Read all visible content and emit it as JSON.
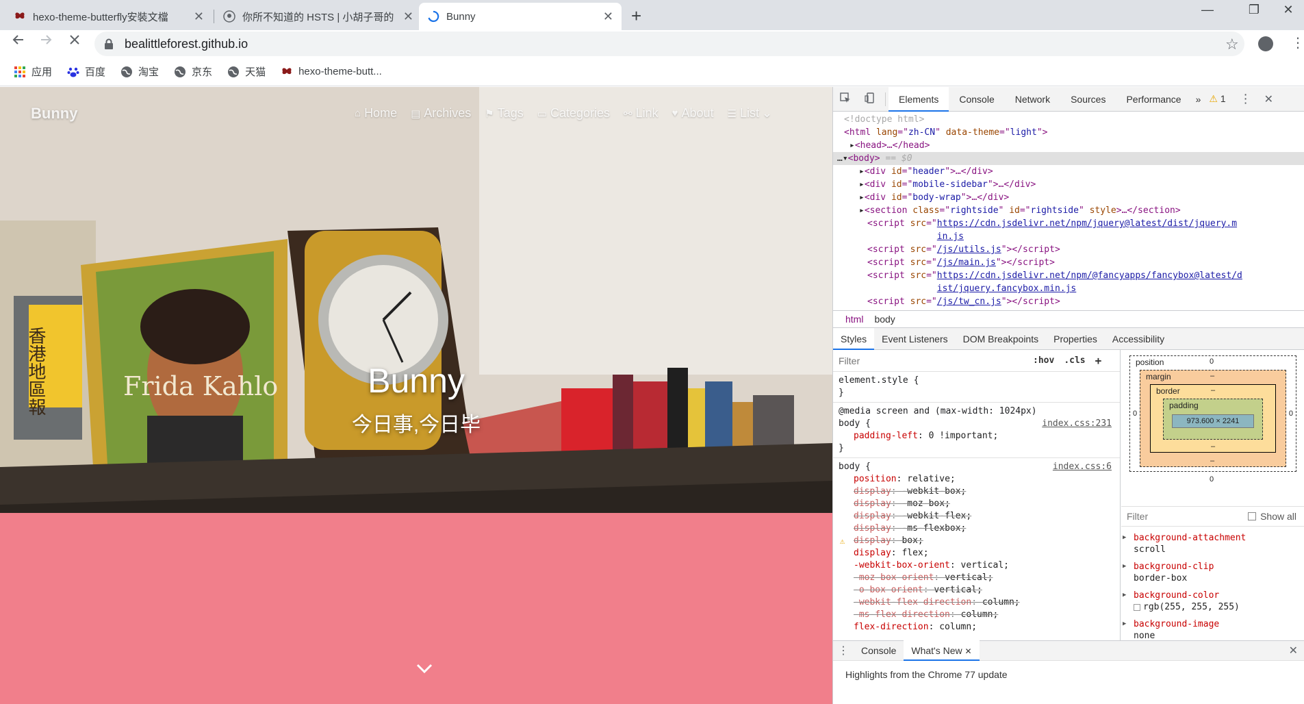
{
  "browser": {
    "tabs": [
      {
        "title": "hexo-theme-butterfly安裝文檔",
        "close": "✕"
      },
      {
        "title": "你所不知道的 HSTS | 小胡子哥的",
        "close": "✕"
      },
      {
        "title": "Bunny",
        "close": "✕"
      }
    ],
    "new_tab": "+",
    "window_controls": {
      "minimize": "—",
      "restore": "❐",
      "close": "✕"
    },
    "url": "bealittleforest.github.io",
    "bookmarks": [
      {
        "label": "应用",
        "icon": "apps-grid-icon"
      },
      {
        "label": "百度",
        "icon": "baidu-paw-icon"
      },
      {
        "label": "淘宝",
        "icon": "globe-icon"
      },
      {
        "label": "京东",
        "icon": "globe-icon"
      },
      {
        "label": "天猫",
        "icon": "globe-icon"
      },
      {
        "label": "hexo-theme-butt...",
        "icon": "butterfly-icon"
      }
    ]
  },
  "page": {
    "brand": "Bunny",
    "menu": [
      {
        "label": "Home",
        "icon": "⌂"
      },
      {
        "label": "Archives",
        "icon": "▤"
      },
      {
        "label": "Tags",
        "icon": "⚑"
      },
      {
        "label": "Categories",
        "icon": "▭"
      },
      {
        "label": "Link",
        "icon": "⚯"
      },
      {
        "label": "About",
        "icon": "♥"
      },
      {
        "label": "List",
        "icon": "☰",
        "suffix": "⌄"
      }
    ],
    "hero_title": "Bunny",
    "hero_subtitle": "今日事,今日毕",
    "hero_image_text": "Frida Kahlo",
    "hero_image_text_cn": "香港地區報",
    "accent_color": "#f17f8b"
  },
  "devtools": {
    "tabs": [
      "Elements",
      "Console",
      "Network",
      "Sources",
      "Performance"
    ],
    "more": "»",
    "warning_count": "1",
    "dom": {
      "doctype": "<!doctype html>",
      "html_open": [
        "<html ",
        "lang",
        "=\"",
        "zh-CN",
        "\" ",
        "data-theme",
        "=\"",
        "light",
        "\">"
      ],
      "head": "<head>…</head>",
      "body_open": "<body>",
      "body_marker": " == $0",
      "children": [
        {
          "tag": "div",
          "attr": "id",
          "val": "header"
        },
        {
          "tag": "div",
          "attr": "id",
          "val": "mobile-sidebar"
        },
        {
          "tag": "div",
          "attr": "id",
          "val": "body-wrap"
        }
      ],
      "section": {
        "class": "rightside",
        "id": "rightside"
      },
      "scripts": [
        "https://cdn.jsdelivr.net/npm/jquery@latest/dist/jquery.min.js",
        "/js/utils.js",
        "/js/main.js",
        "https://cdn.jsdelivr.net/npm/@fancyapps/fancybox@latest/dist/jquery.fancybox.min.js",
        "/js/tw_cn.js"
      ]
    },
    "breadcrumbs": [
      "html",
      "body"
    ],
    "styles_tabs": [
      "Styles",
      "Event Listeners",
      "DOM Breakpoints",
      "Properties",
      "Accessibility"
    ],
    "filter_placeholder": "Filter",
    "filter_hov": ":hov",
    "filter_cls": ".cls",
    "filter_add": "+",
    "rules": {
      "element_style": "element.style {",
      "media": "@media screen and (max-width: 1024px)",
      "body_sel": "body {",
      "close": "}",
      "src1": "index.css:231",
      "src2": "index.css:6",
      "media_prop": {
        "name": "padding-left",
        "value": "0 !important;"
      },
      "body_props": [
        {
          "name": "position",
          "value": "relative;",
          "struck": false
        },
        {
          "name": "display",
          "value": "-webkit-box;",
          "struck": true
        },
        {
          "name": "display",
          "value": "-moz-box;",
          "struck": true
        },
        {
          "name": "display",
          "value": "-webkit-flex;",
          "struck": true
        },
        {
          "name": "display",
          "value": "-ms-flexbox;",
          "struck": true
        },
        {
          "name": "display",
          "value": "box;",
          "struck": true,
          "warn": true
        },
        {
          "name": "display",
          "value": "flex;",
          "struck": false
        },
        {
          "name": "-webkit-box-orient",
          "value": "vertical;",
          "struck": false
        },
        {
          "name": "-moz-box-orient",
          "value": "vertical;",
          "struck": true
        },
        {
          "name": "-o-box-orient",
          "value": "vertical;",
          "struck": true
        },
        {
          "name": "-webkit-flex-direction",
          "value": "column;",
          "struck": true
        },
        {
          "name": "-ms-flex-direction",
          "value": "column;",
          "struck": true
        },
        {
          "name": "flex-direction",
          "value": "column;",
          "struck": false
        }
      ]
    },
    "box_model": {
      "position_label": "position",
      "position_value": "0",
      "margin_label": "margin",
      "border_label": "border",
      "padding_label": "padding",
      "dash": "–",
      "content": "973.600 × 2241",
      "side_zero": "0"
    },
    "computed_filter": "Filter",
    "show_all": "Show all",
    "computed": [
      {
        "name": "background-attachment",
        "value": "scroll"
      },
      {
        "name": "background-clip",
        "value": "border-box"
      },
      {
        "name": "background-color",
        "value": "rgb(255, 255, 255)",
        "swatch": "#ffffff"
      },
      {
        "name": "background-image",
        "value": "none"
      }
    ],
    "drawer_tabs": [
      "Console",
      "What's New"
    ],
    "drawer_close": "✕",
    "drawer_text": "Highlights from the Chrome 77 update"
  }
}
